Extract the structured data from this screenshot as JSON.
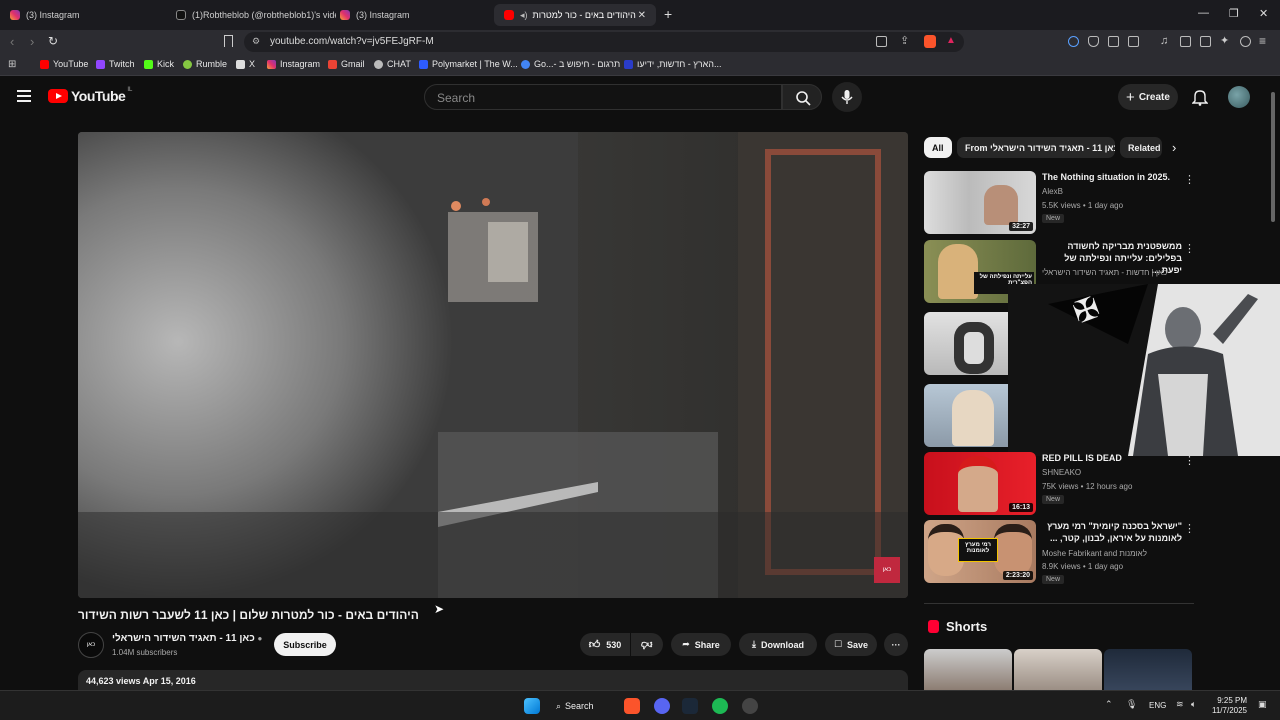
{
  "browser": {
    "tabs": [
      {
        "label": "(3) Instagram",
        "icon": "instagram-icon"
      },
      {
        "label": "(1)Robtheblob (@robtheblob1)'s vide",
        "icon": "tiktok-icon"
      },
      {
        "label": "(3) Instagram",
        "icon": "instagram-icon"
      },
      {
        "label": "היהודים באים - כור למטרות",
        "icon": "youtube-icon",
        "active": true
      }
    ],
    "url": "youtube.com/watch?v=jv5FEJgRF-M",
    "bookmarks": [
      {
        "label": "YouTube",
        "color": "#ff0000"
      },
      {
        "label": "Twitch",
        "color": "#9146ff"
      },
      {
        "label": "Kick",
        "color": "#53fc18"
      },
      {
        "label": "Rumble",
        "color": "#85c742"
      },
      {
        "label": "X",
        "color": "#ffffff"
      },
      {
        "label": "Instagram",
        "color": "#e1306c"
      },
      {
        "label": "Gmail",
        "color": "#ea4335"
      },
      {
        "label": "CHAT",
        "color": "#cccccc"
      },
      {
        "label": "Polymarket | The W...",
        "color": "#2e5cff"
      },
      {
        "label": "Go...- תרגום - חיפוש ב",
        "color": "#4285f4"
      },
      {
        "label": "הארץ - חדשות, ידיעו...",
        "color": "#2a3cc9"
      }
    ]
  },
  "youtube": {
    "logo_text": "YouTube",
    "region": "IL",
    "search_placeholder": "Search",
    "create_label": "Create"
  },
  "video": {
    "watermark": "כאן",
    "title": "היהודים באים - כור למטרות שלום | כאן 11 לשעבר רשות השידור",
    "channel": "כאן 11 - תאגיד השידור הישראלי",
    "channel_logo": "כאן",
    "subscribers": "1.04M subscribers",
    "subscribe_label": "Subscribe",
    "likes": "530",
    "share_label": "Share",
    "download_label": "Download",
    "save_label": "Save",
    "views_date": "44,623 views  Apr 15, 2016"
  },
  "sidebar": {
    "chips": [
      "All",
      "From כאן 11 - תאגיד השידור הישראלי",
      "Related"
    ],
    "recommendations": [
      {
        "title": "The Nothing situation in 2025.",
        "channel": "AlexB",
        "meta": "5.5K views • 1 day ago",
        "badge": "New",
        "duration": "32:27"
      },
      {
        "title": "ממשפטנית מבריקה לחשודה בפלילים: עלייתה ונפילתה של יפעת ...",
        "channel": "כאן | חדשות - תאגיד השידור הישראלי",
        "thumb_text": "עלייתה ונפילתה של הפצ\"רית"
      },
      {
        "title": "",
        "channel": "",
        "meta": ""
      },
      {
        "title": "",
        "channel": "",
        "meta": ""
      },
      {
        "title": "RED PILL IS DEAD",
        "channel": "SHNEAKO",
        "meta": "75K views • 12 hours ago",
        "badge": "New",
        "duration": "16:13"
      },
      {
        "title": "\"ישראל בסכנה קיומית\" רמי מערץ לאומנות על איראן, לבנון, קטר, ...",
        "channel": "Moshe Fabrikant and לאומנות",
        "meta": "8.9K views • 1 day ago",
        "badge": "New",
        "duration": "2:23:20",
        "thumb_text": "רמי מערץ לאומנות"
      }
    ],
    "shorts_label": "Shorts"
  },
  "taskbar": {
    "search_label": "Search",
    "language": "ENG",
    "time": "9:25 PM",
    "date": "11/7/2025"
  }
}
